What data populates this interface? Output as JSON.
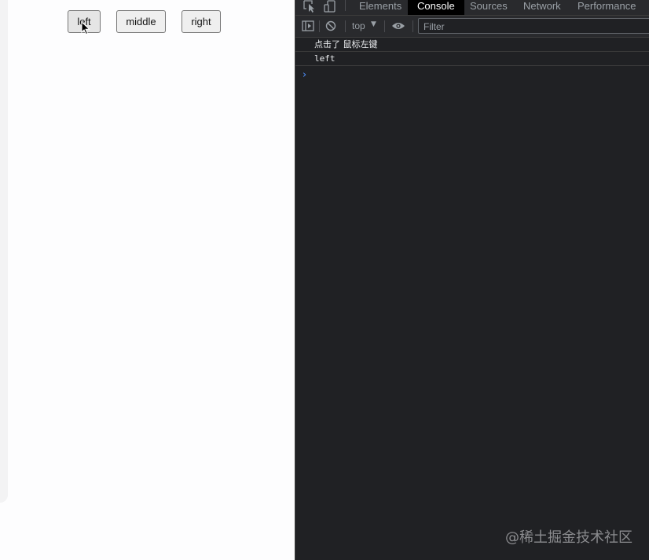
{
  "page": {
    "buttons": [
      {
        "label": "left"
      },
      {
        "label": "middle"
      },
      {
        "label": "right"
      }
    ]
  },
  "devtools": {
    "tabs": [
      "Elements",
      "Console",
      "Sources",
      "Network",
      "Performance"
    ],
    "active_tab": "Console",
    "toolbar": {
      "context": "top",
      "filter_placeholder": "Filter"
    },
    "console": {
      "messages": [
        "点击了 鼠标左键",
        "left"
      ],
      "prompt": "›"
    }
  },
  "watermark": "@稀土掘金技术社区",
  "colors": {
    "devtools_bg": "#202124",
    "active_tab_bg": "#000000",
    "prompt_blue": "#4d90fe"
  }
}
